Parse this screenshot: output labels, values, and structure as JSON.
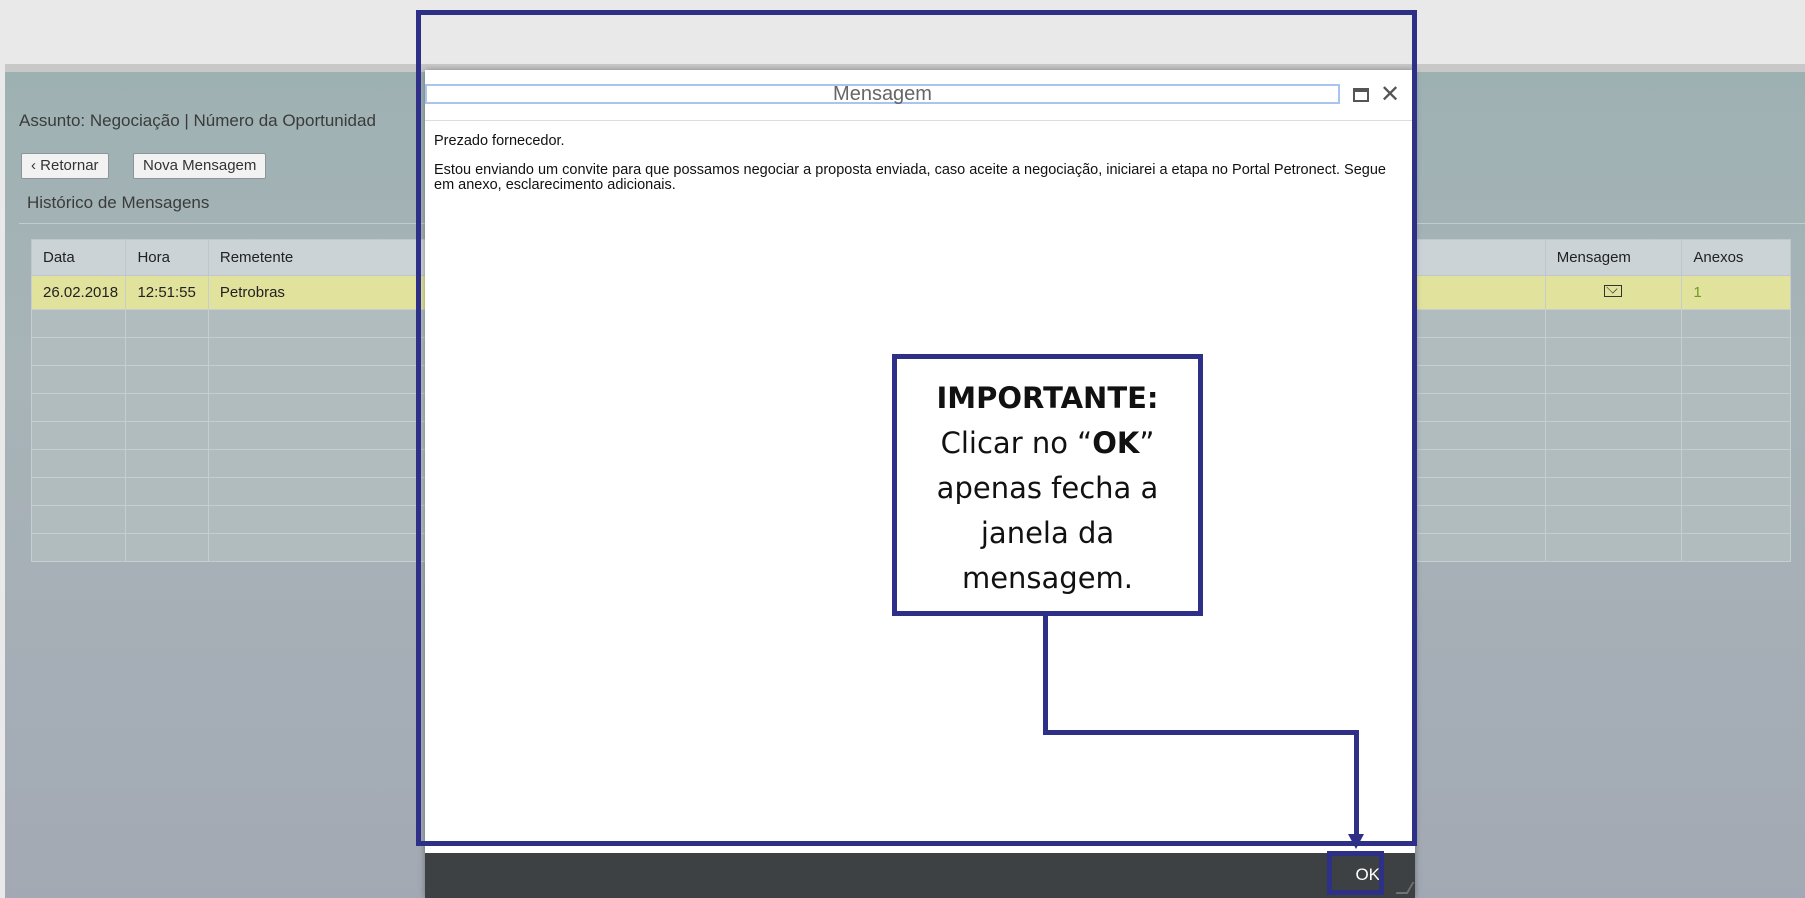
{
  "app": {
    "subject": "Assunto: Negociação | Número da Oportunidad",
    "buttons": {
      "back": "Retornar",
      "new_message": "Nova Mensagem"
    },
    "history_title": "Histórico de Mensagens",
    "table": {
      "columns": [
        "Data",
        "Hora",
        "Remetente",
        "Mensagem",
        "Anexos"
      ],
      "rows": [
        {
          "date": "26.02.2018",
          "time": "12:51:55",
          "sender": "Petrobras",
          "message_icon": "envelope-icon",
          "attachments": "1"
        }
      ],
      "empty_rows": 9
    }
  },
  "dialog": {
    "title": "Mensagem",
    "body": {
      "greeting": "Prezado fornecedor.",
      "message": "Estou enviando um convite para que possamos negociar a proposta enviada, caso aceite a negociação, iniciarei a etapa no Portal Petronect. Segue em anexo, esclarecimento adicionais."
    },
    "ok_label": "OK"
  },
  "callout": {
    "heading": "IMPORTANTE:",
    "line1_pre": "Clicar no “",
    "line1_bold": "OK",
    "line1_post": "”",
    "line2": "apenas fecha a",
    "line3": "janela da",
    "line4": "mensagem."
  },
  "colors": {
    "annotation": "#2e2f86",
    "selected_row": "#e1e29c",
    "footer": "#3d4143"
  }
}
